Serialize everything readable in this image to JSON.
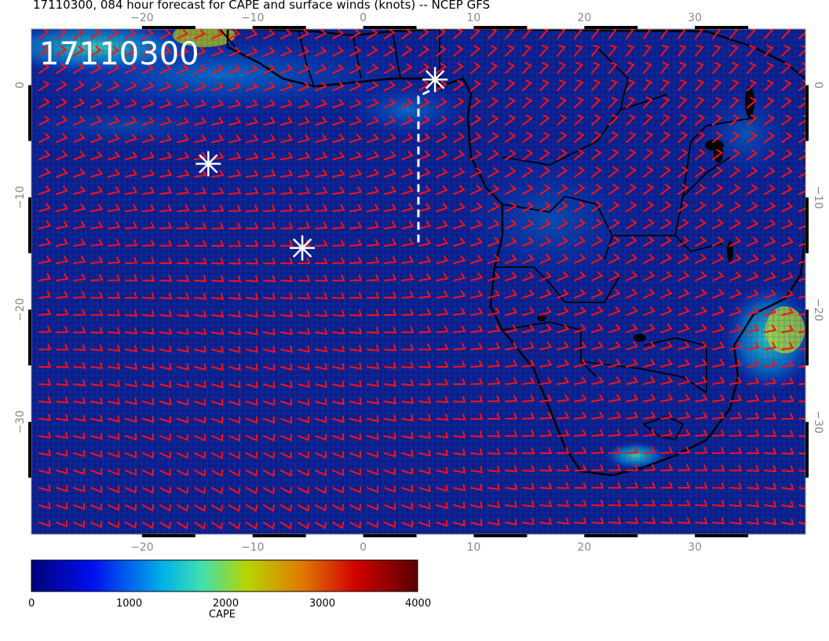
{
  "title": "17110300, 084 hour forecast for CAPE and surface winds (knots) -- NCEP GFS",
  "stamp": "17110300",
  "map": {
    "lon_range": [
      -30,
      40
    ],
    "lat_range": [
      -40,
      5
    ],
    "lon_ticks": [
      "−20",
      "−10",
      "0",
      "10",
      "20",
      "30"
    ],
    "lat_ticks": [
      "0",
      "−10",
      "−20",
      "−30"
    ],
    "background_color": "#0b1f8c",
    "wind_barb_color": "#ff1010",
    "coastline_color": "#000000",
    "markers": [
      {
        "name": "white-asterisk",
        "lon": -14,
        "lat": -7
      },
      {
        "name": "white-asterisk",
        "lon": -5.5,
        "lat": -14.5
      },
      {
        "name": "white-asterisk",
        "lon": 6.5,
        "lat": 0.5
      }
    ],
    "track": {
      "style": "white-dashed",
      "points": [
        [
          5,
          -14
        ],
        [
          5,
          -1
        ],
        [
          6,
          -0.5
        ]
      ]
    }
  },
  "colorbar": {
    "label": "CAPE",
    "ticks": [
      "0",
      "1000",
      "2000",
      "3000",
      "4000"
    ],
    "range": [
      0,
      4000
    ],
    "colors": [
      "#000080",
      "#0000ff",
      "#00c0e0",
      "#40e0a0",
      "#c0d000",
      "#e08000",
      "#d00000",
      "#600000"
    ]
  }
}
